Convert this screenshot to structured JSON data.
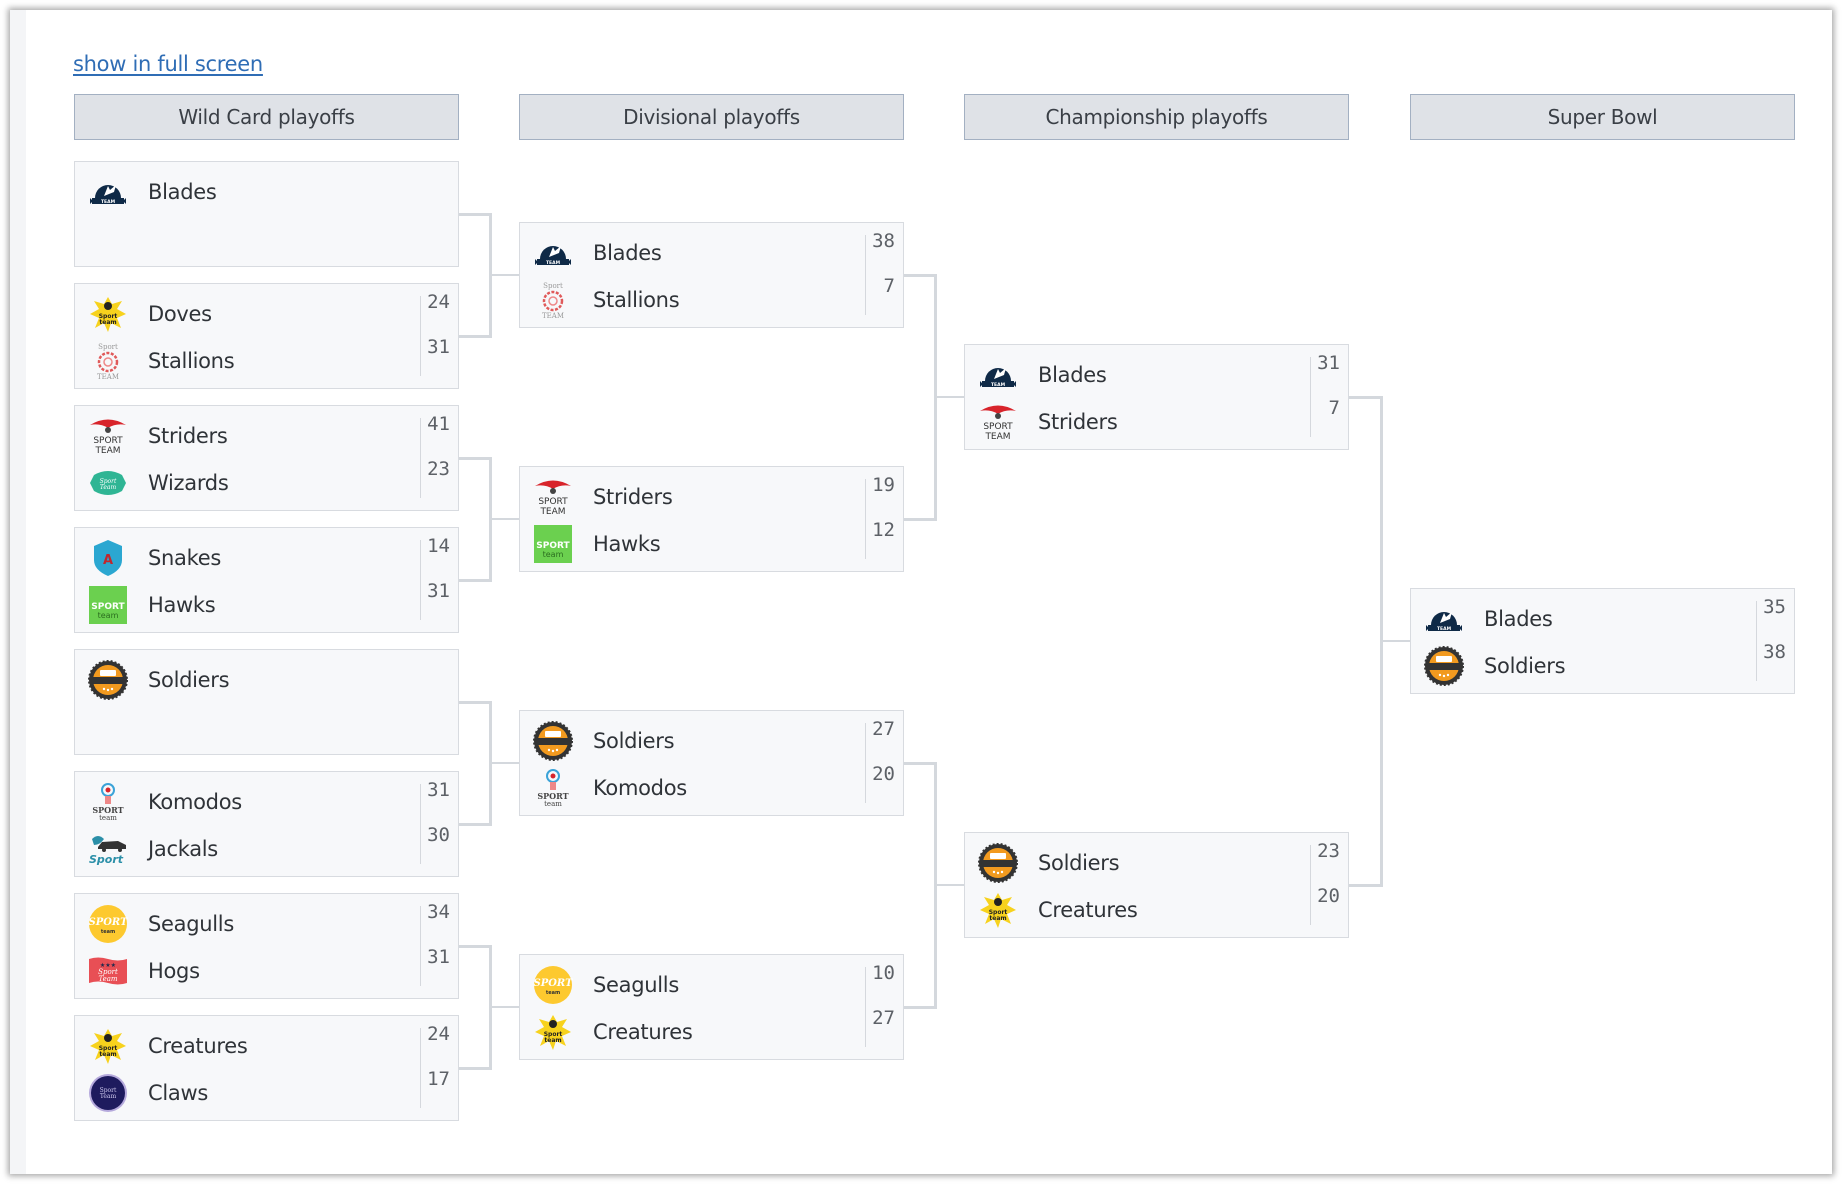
{
  "link": {
    "label": "show in full screen"
  },
  "colors": {
    "header_bg": "#dfe2e7",
    "header_border": "#a3b0c2",
    "link": "#2f6db5",
    "match_bg": "#f7f8fa",
    "connector": "#d4d8dd"
  },
  "rounds": [
    {
      "title": "Wild Card playoffs",
      "matches": [
        {
          "teams": [
            {
              "name": "Blades",
              "logo": "blades-logo",
              "score": null
            }
          ],
          "bye": true
        },
        {
          "teams": [
            {
              "name": "Doves",
              "logo": "doves-logo",
              "score": "24"
            },
            {
              "name": "Stallions",
              "logo": "stallions-logo",
              "score": "31"
            }
          ]
        },
        {
          "teams": [
            {
              "name": "Striders",
              "logo": "striders-logo",
              "score": "41"
            },
            {
              "name": "Wizards",
              "logo": "wizards-logo",
              "score": "23"
            }
          ]
        },
        {
          "teams": [
            {
              "name": "Snakes",
              "logo": "snakes-logo",
              "score": "14"
            },
            {
              "name": "Hawks",
              "logo": "hawks-logo",
              "score": "31"
            }
          ]
        },
        {
          "teams": [
            {
              "name": "Soldiers",
              "logo": "soldiers-logo",
              "score": null
            }
          ],
          "bye": true
        },
        {
          "teams": [
            {
              "name": "Komodos",
              "logo": "komodos-logo",
              "score": "31"
            },
            {
              "name": "Jackals",
              "logo": "jackals-logo",
              "score": "30"
            }
          ]
        },
        {
          "teams": [
            {
              "name": "Seagulls",
              "logo": "seagulls-logo",
              "score": "34"
            },
            {
              "name": "Hogs",
              "logo": "hogs-logo",
              "score": "31"
            }
          ]
        },
        {
          "teams": [
            {
              "name": "Creatures",
              "logo": "creatures-logo",
              "score": "24"
            },
            {
              "name": "Claws",
              "logo": "claws-logo",
              "score": "17"
            }
          ]
        }
      ]
    },
    {
      "title": "Divisional playoffs",
      "matches": [
        {
          "teams": [
            {
              "name": "Blades",
              "logo": "blades-logo",
              "score": "38"
            },
            {
              "name": "Stallions",
              "logo": "stallions-logo",
              "score": "7"
            }
          ]
        },
        {
          "teams": [
            {
              "name": "Striders",
              "logo": "striders-logo",
              "score": "19"
            },
            {
              "name": "Hawks",
              "logo": "hawks-logo",
              "score": "12"
            }
          ]
        },
        {
          "teams": [
            {
              "name": "Soldiers",
              "logo": "soldiers-logo",
              "score": "27"
            },
            {
              "name": "Komodos",
              "logo": "komodos-logo",
              "score": "20"
            }
          ]
        },
        {
          "teams": [
            {
              "name": "Seagulls",
              "logo": "seagulls-logo",
              "score": "10"
            },
            {
              "name": "Creatures",
              "logo": "creatures-logo",
              "score": "27"
            }
          ]
        }
      ]
    },
    {
      "title": "Championship playoffs",
      "matches": [
        {
          "teams": [
            {
              "name": "Blades",
              "logo": "blades-logo",
              "score": "31"
            },
            {
              "name": "Striders",
              "logo": "striders-logo",
              "score": "7"
            }
          ]
        },
        {
          "teams": [
            {
              "name": "Soldiers",
              "logo": "soldiers-logo",
              "score": "23"
            },
            {
              "name": "Creatures",
              "logo": "creatures-logo",
              "score": "20"
            }
          ]
        }
      ]
    },
    {
      "title": "Super Bowl",
      "matches": [
        {
          "teams": [
            {
              "name": "Blades",
              "logo": "blades-logo",
              "score": "35"
            },
            {
              "name": "Soldiers",
              "logo": "soldiers-logo",
              "score": "38"
            }
          ]
        }
      ]
    }
  ]
}
